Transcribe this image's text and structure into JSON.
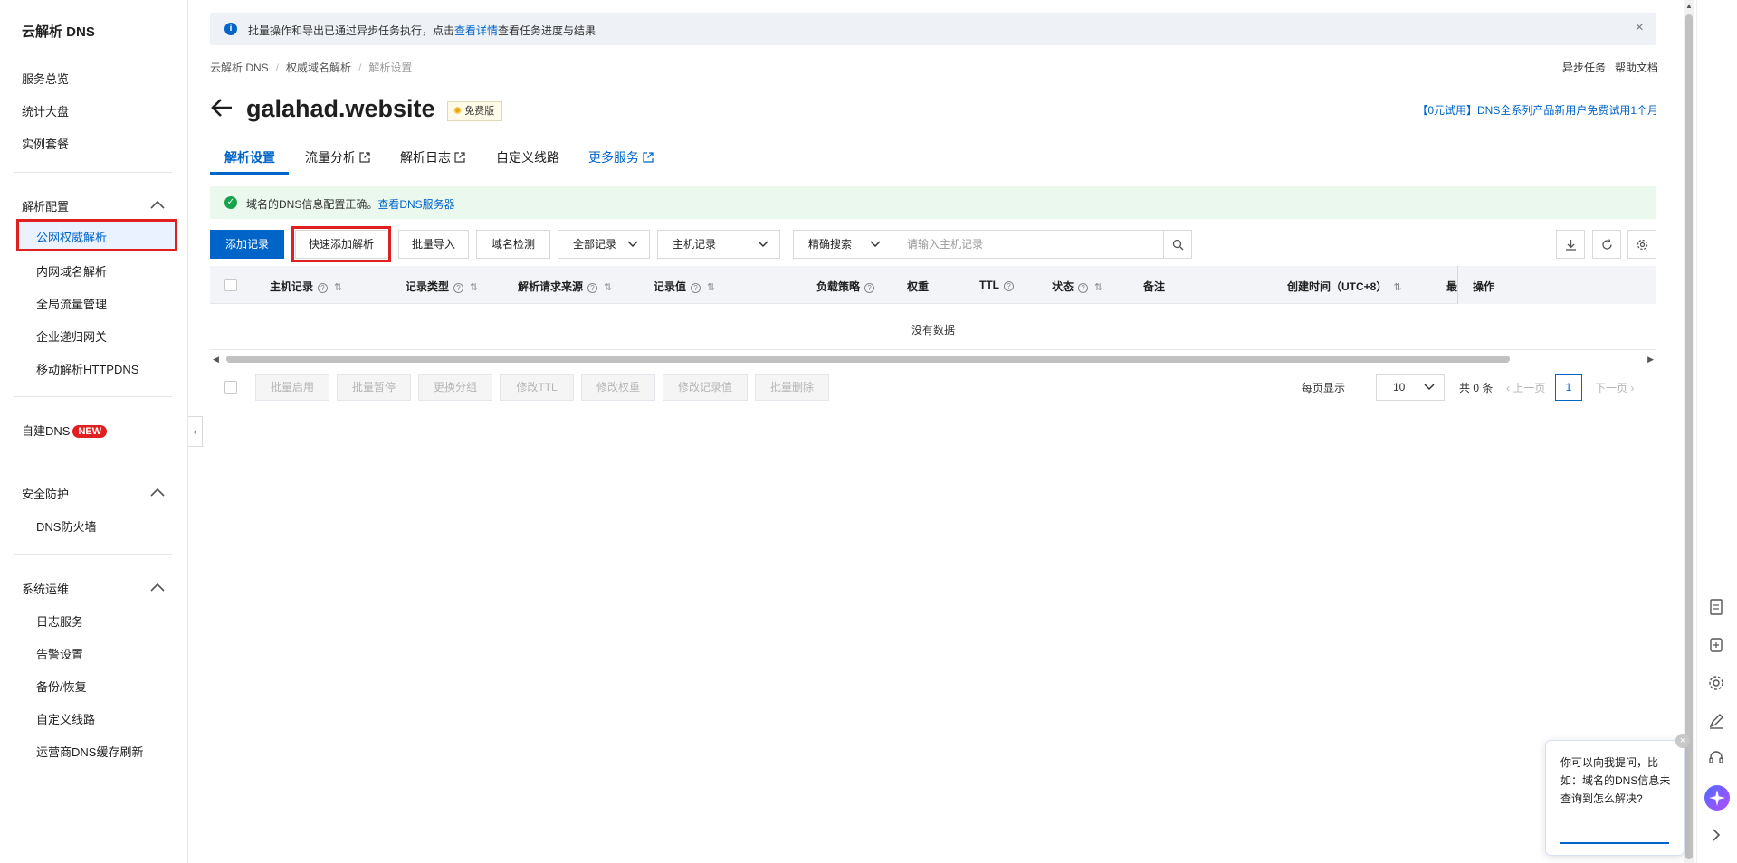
{
  "sidebar": {
    "brand": "云解析 DNS",
    "top_items": [
      "服务总览",
      "统计大盘",
      "实例套餐"
    ],
    "section_resolve": {
      "title": "解析配置",
      "items": [
        "公网权威解析",
        "内网域名解析",
        "全局流量管理",
        "企业递归网关",
        "移动解析HTTPDNS"
      ]
    },
    "self_dns": {
      "label": "自建DNS",
      "badge": "NEW"
    },
    "section_security": {
      "title": "安全防护",
      "items": [
        "DNS防火墙"
      ]
    },
    "section_ops": {
      "title": "系统运维",
      "items": [
        "日志服务",
        "告警设置",
        "备份/恢复",
        "自定义线路",
        "运营商DNS缓存刷新"
      ]
    },
    "collapse_glyph": "‹"
  },
  "notice": {
    "text_before": "批量操作和导出已通过异步任务执行，点击",
    "link": "查看详情",
    "text_after": "查看任务进度与结果",
    "close": "×"
  },
  "breadcrumb": [
    "云解析 DNS",
    "权威域名解析",
    "解析设置"
  ],
  "top_links": [
    "异步任务",
    "帮助文档"
  ],
  "header": {
    "domain": "galahad.website",
    "badge": "免费版",
    "promo": "【0元试用】DNS全系列产品新用户免费试用1个月"
  },
  "tabs": [
    "解析设置",
    "流量分析",
    "解析日志",
    "自定义线路",
    "更多服务"
  ],
  "success": {
    "text": "域名的DNS信息配置正确。",
    "link": "查看DNS服务器"
  },
  "toolbar": {
    "add_record": "添加记录",
    "quick_add": "快速添加解析",
    "batch_import": "批量导入",
    "domain_check": "域名检测",
    "filter_all": "全部记录",
    "filter_host": "主机记录",
    "filter_exact": "精确搜索",
    "search_placeholder": "请输入主机记录"
  },
  "table": {
    "columns": [
      "主机记录",
      "记录类型",
      "解析请求来源",
      "记录值",
      "负载策略",
      "权重",
      "TTL",
      "状态",
      "备注",
      "创建时间（UTC+8）",
      "最",
      "操作"
    ],
    "empty_text": "没有数据"
  },
  "batch_actions": [
    "批量启用",
    "批量暂停",
    "更换分组",
    "修改TTL",
    "修改权重",
    "修改记录值",
    "批量删除"
  ],
  "pagination": {
    "per_page_label": "每页显示",
    "per_page_value": "10",
    "total": "共 0 条",
    "prev": "上一页",
    "current": "1",
    "next": "下一页"
  },
  "assistant": {
    "tip": "你可以向我提问，比如：域名的DNS信息未查询到怎么解决?"
  },
  "colors": {
    "primary": "#0064c8",
    "highlight_red": "#e02020",
    "success_green": "#16a34a"
  }
}
